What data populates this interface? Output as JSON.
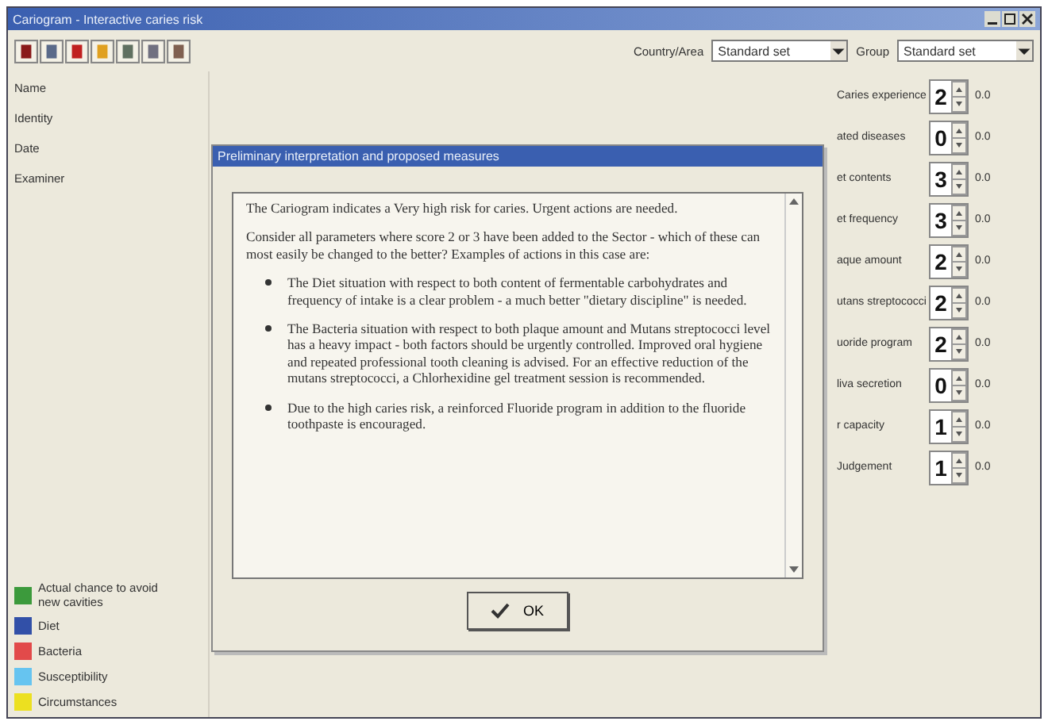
{
  "window": {
    "title": "Cariogram - Interactive caries risk"
  },
  "toolbar": {
    "country_label": "Country/Area",
    "country_value": "Standard set",
    "group_label": "Group",
    "group_value": "Standard set"
  },
  "patient_fields": [
    "Name",
    "Identity",
    "Date",
    "Examiner"
  ],
  "legend": [
    {
      "label": "Actual chance to avoid new cavities",
      "color": "#3c9a3c"
    },
    {
      "label": "Diet",
      "color": "#3250a8"
    },
    {
      "label": "Bacteria",
      "color": "#e24a4a"
    },
    {
      "label": "Susceptibility",
      "color": "#66c4f0"
    },
    {
      "label": "Circumstances",
      "color": "#ece020"
    }
  ],
  "factors": [
    {
      "label": "Caries experience",
      "value": "2",
      "reading": "0.0"
    },
    {
      "label": "ated diseases",
      "value": "0",
      "reading": "0.0"
    },
    {
      "label": "et contents",
      "value": "3",
      "reading": "0.0"
    },
    {
      "label": "et frequency",
      "value": "3",
      "reading": "0.0"
    },
    {
      "label": "aque amount",
      "value": "2",
      "reading": "0.0"
    },
    {
      "label": "utans streptococci",
      "value": "2",
      "reading": "0.0"
    },
    {
      "label": "uoride program",
      "value": "2",
      "reading": "0.0"
    },
    {
      "label": "liva secretion",
      "value": "0",
      "reading": "0.0"
    },
    {
      "label": "r capacity",
      "value": "1",
      "reading": "0.0"
    },
    {
      "label": "Judgement",
      "value": "1",
      "reading": "0.0"
    }
  ],
  "dialog": {
    "title": "Preliminary interpretation and proposed measures",
    "paragraphs": [
      "The Cariogram indicates a Very high risk for caries. Urgent actions are needed.",
      "Consider all parameters where score 2 or 3 have been added to the Sector - which of these can most easily be changed to the better? Examples of actions in this case are:"
    ],
    "bullets": [
      "The Diet situation with respect to both content of fermentable carbohydrates and frequency of intake is a clear problem - a much better \"dietary discipline\" is needed.",
      "The Bacteria situation with respect to both plaque amount and Mutans streptococci level has a heavy impact - both factors should be urgently controlled. Improved oral hygiene and repeated professional tooth cleaning is advised. For an effective reduction of the mutans streptococci, a Chlorhexidine gel treatment session is recommended.",
      "Due to the high caries risk, a reinforced Fluoride program in addition to the fluoride toothpaste is encouraged."
    ],
    "ok_label": "OK"
  }
}
